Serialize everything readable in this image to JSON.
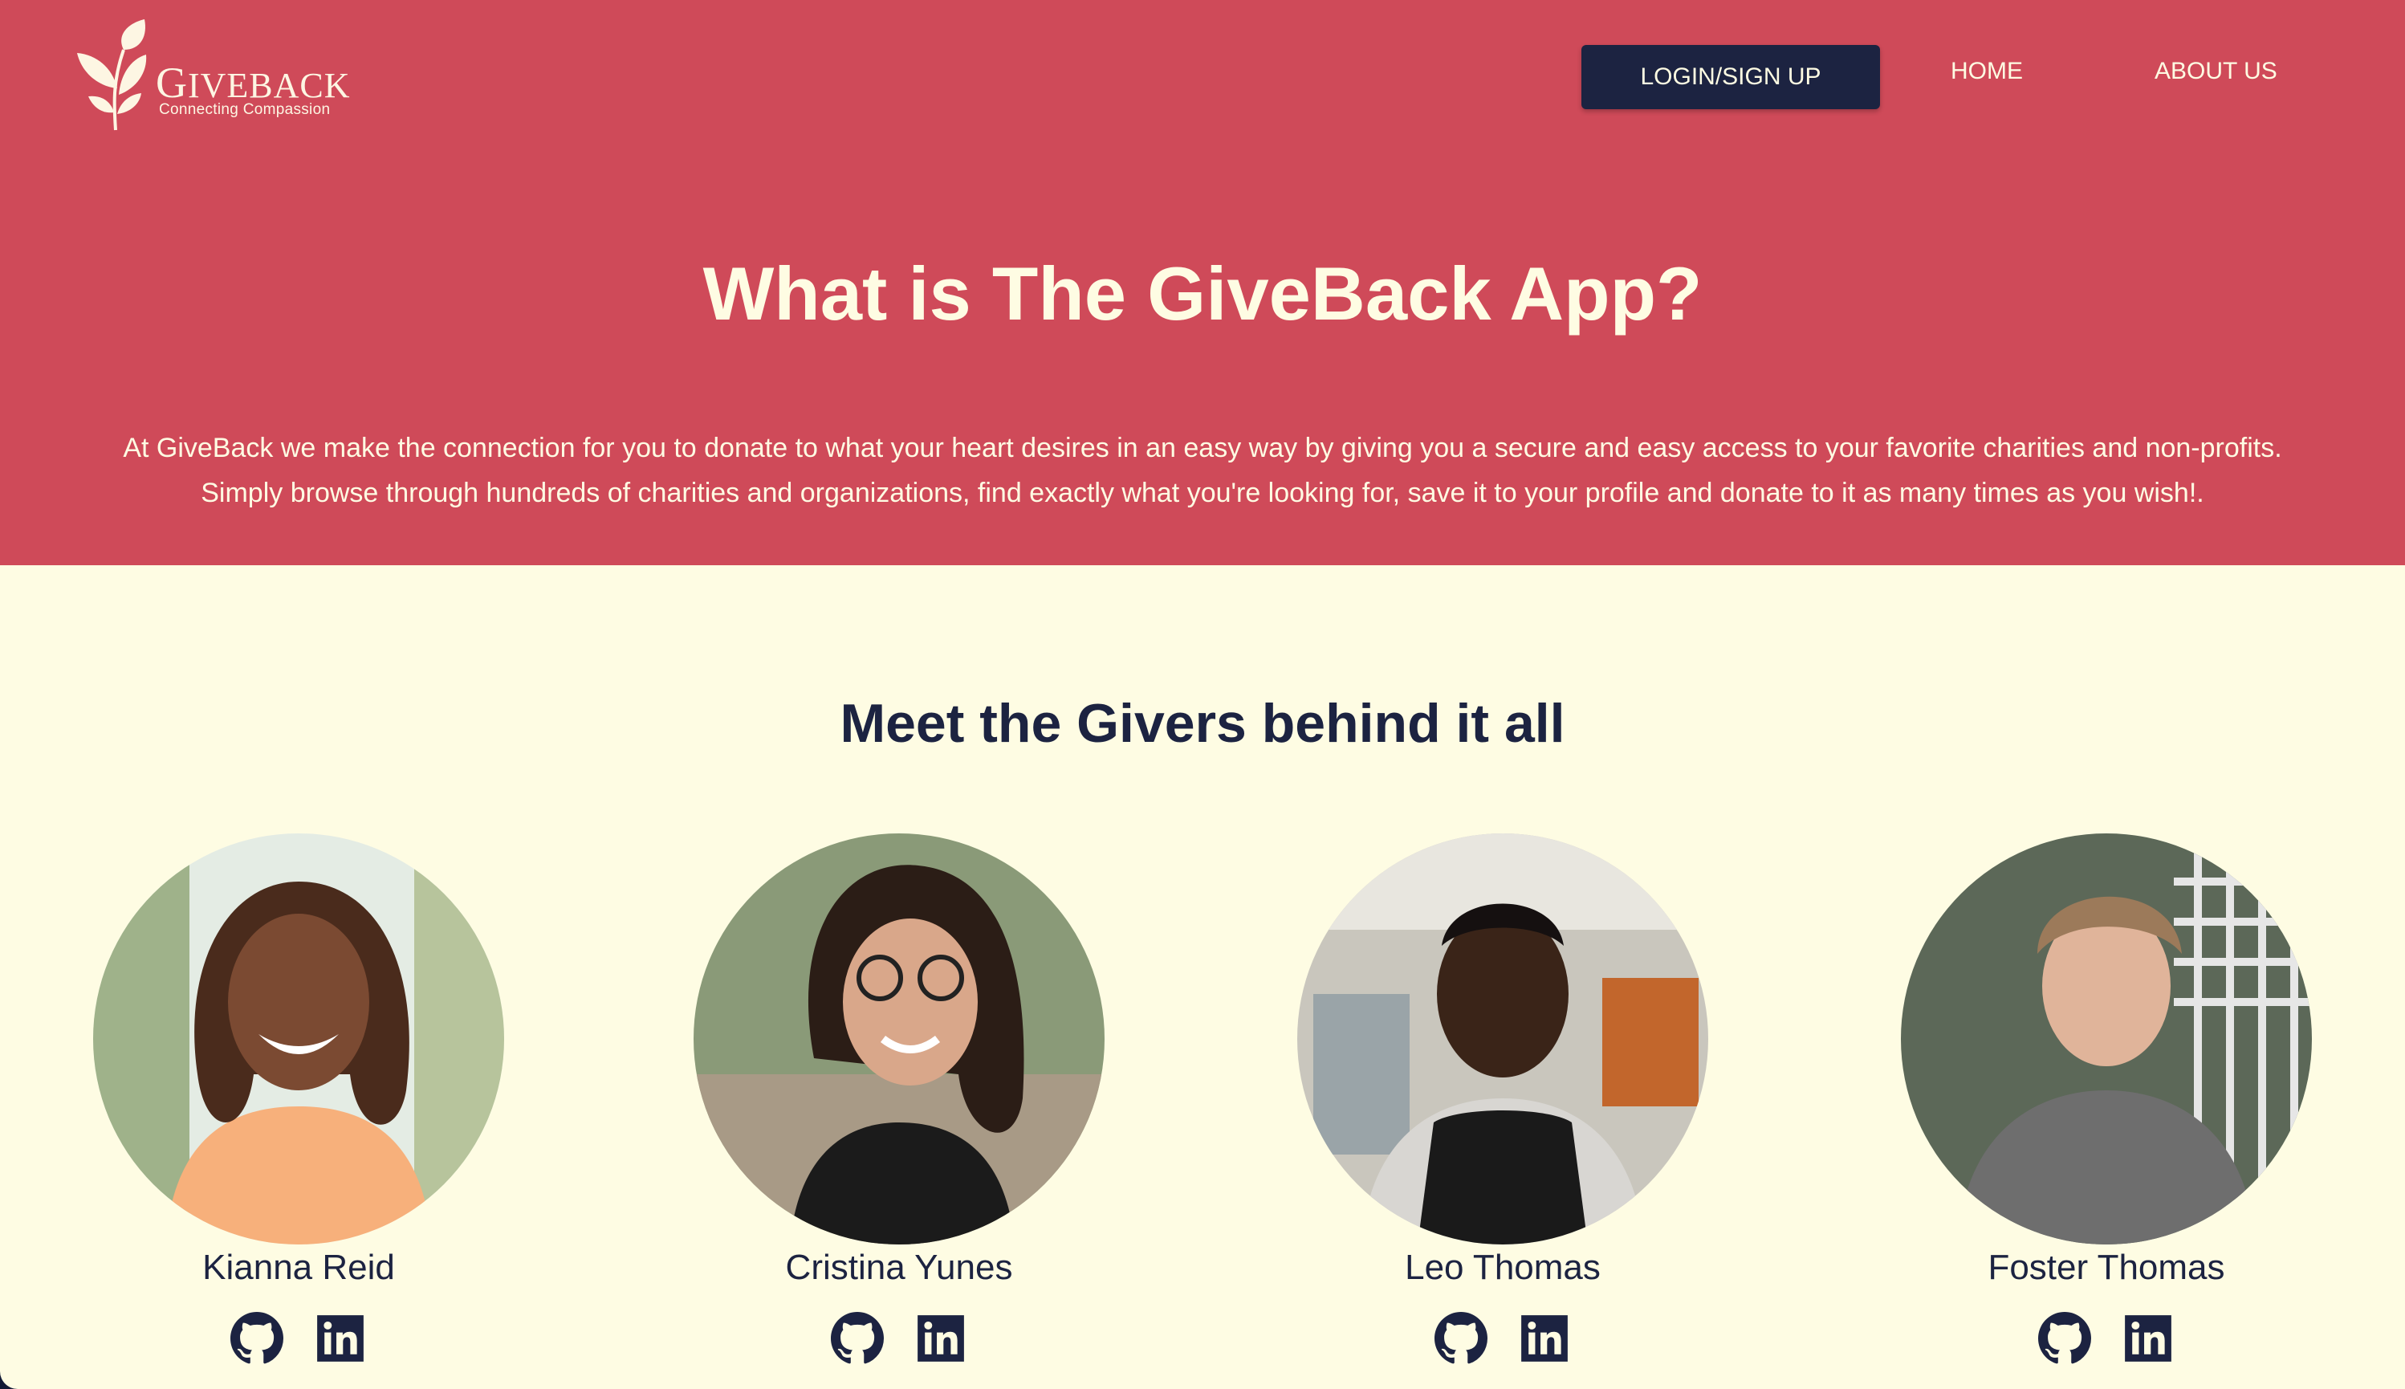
{
  "header": {
    "brand_first": "G",
    "brand_rest": "IVEBACK",
    "tagline": "Connecting Compassion",
    "login_label": "LOGIN/SIGN UP",
    "home_label": "HOME",
    "about_label": "ABOUT US"
  },
  "hero": {
    "title": "What is The GiveBack App?",
    "line1": "At GiveBack we make the connection for you to donate to what your heart desires in an easy way by giving you a secure and easy access to your favorite charities and non-profits.",
    "line2": "Simply browse through hundreds of charities and organizations, find exactly what you're looking for, save it to your profile and donate to it as many times as you wish!."
  },
  "team": {
    "title": "Meet the Givers behind it all",
    "members": [
      {
        "name": "Kianna Reid"
      },
      {
        "name": "Cristina Yunes"
      },
      {
        "name": "Leo Thomas"
      },
      {
        "name": "Foster Thomas"
      }
    ]
  },
  "colors": {
    "hero_bg": "#cf4a59",
    "page_bg": "#fefce3",
    "navy": "#1c2341",
    "cream": "#fefce3"
  },
  "icons": [
    "leaf-logo-icon",
    "github-icon",
    "linkedin-icon"
  ]
}
